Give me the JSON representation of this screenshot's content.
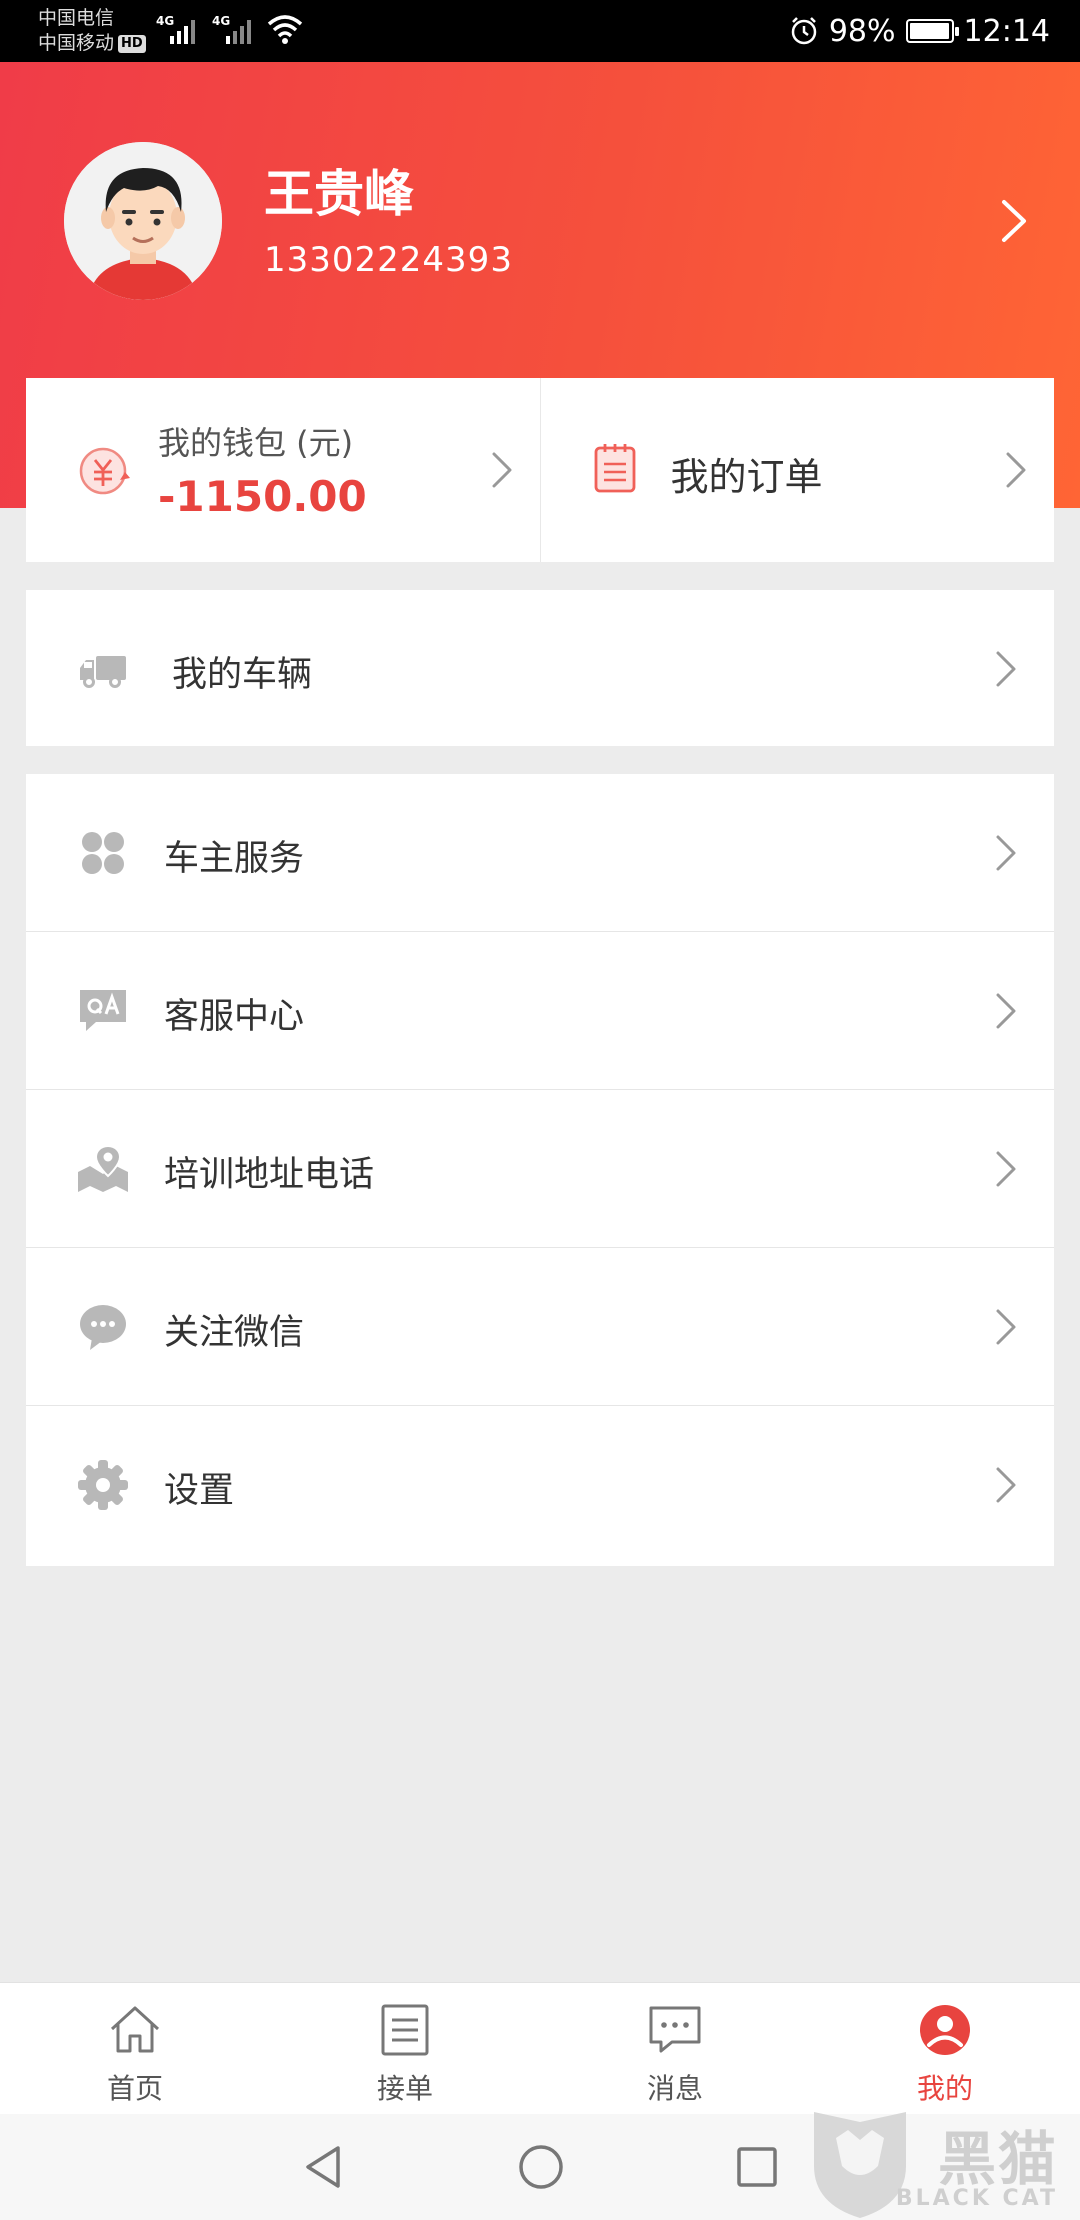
{
  "status_bar": {
    "carrier_1": "中国电信",
    "carrier_2": "中国移动",
    "hd_badge": "HD",
    "net_1": "4G",
    "net_2": "4G",
    "battery": "98%",
    "battery_level": 0.98,
    "time": "12:14"
  },
  "profile": {
    "name": "王贵峰",
    "phone": "13302224393"
  },
  "wallet": {
    "label": "我的钱包 (元)",
    "value": "-1150.00"
  },
  "orders": {
    "label": "我的订单"
  },
  "vehicle": {
    "label": "我的车辆"
  },
  "menu": [
    {
      "label": "车主服务",
      "icon": "grid-icon"
    },
    {
      "label": "客服中心",
      "icon": "qa-chat-icon"
    },
    {
      "label": "培训地址电话",
      "icon": "map-pin-icon"
    },
    {
      "label": "关注微信",
      "icon": "wechat-icon"
    },
    {
      "label": "设置",
      "icon": "gear-icon"
    }
  ],
  "tabs": [
    {
      "label": "首页",
      "icon": "home-icon"
    },
    {
      "label": "接单",
      "icon": "list-icon"
    },
    {
      "label": "消息",
      "icon": "message-icon"
    },
    {
      "label": "我的",
      "icon": "profile-icon",
      "active": true
    }
  ],
  "watermark": {
    "title": "黑猫",
    "subtitle": "BLACK CAT"
  },
  "colors": {
    "accent": "#e8443f",
    "header_start": "#f03c48",
    "header_end": "#ff6535",
    "icon_gray": "#b8b8b8"
  }
}
